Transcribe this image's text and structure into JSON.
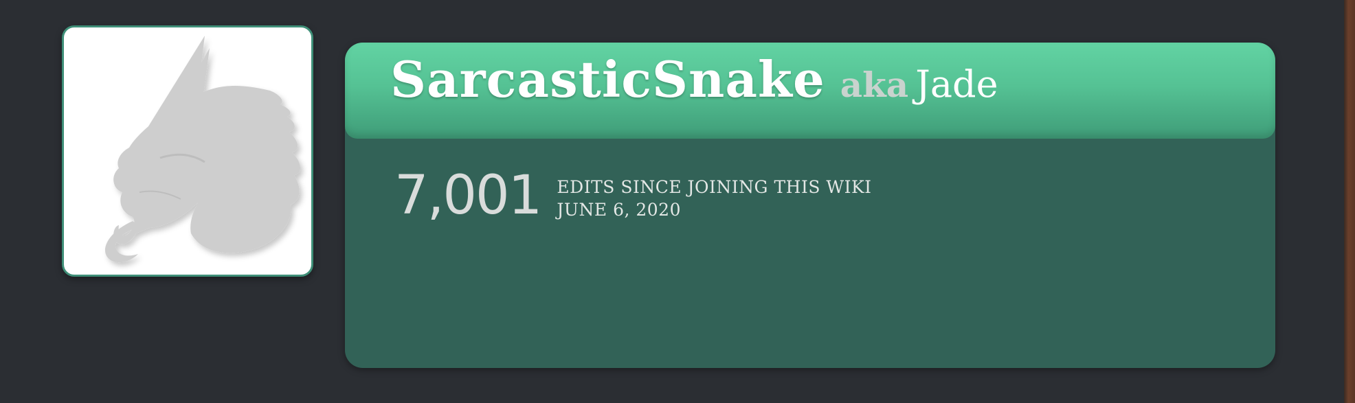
{
  "profile": {
    "username": "SarcasticSnake",
    "aka_label": "aka",
    "real_name": "Jade",
    "edit_count": "7,001",
    "edits_label": "EDITS SINCE JOINING THIS WIKI",
    "join_date": "JUNE 6, 2020"
  },
  "avatar": {
    "icon": "dragon-head-placeholder-icon"
  },
  "colors": {
    "background": "#2b2e33",
    "header_top": "#62d3a3",
    "header_bottom": "#3f9c78",
    "card_body": "#326257",
    "avatar_border": "#3f8f78"
  }
}
